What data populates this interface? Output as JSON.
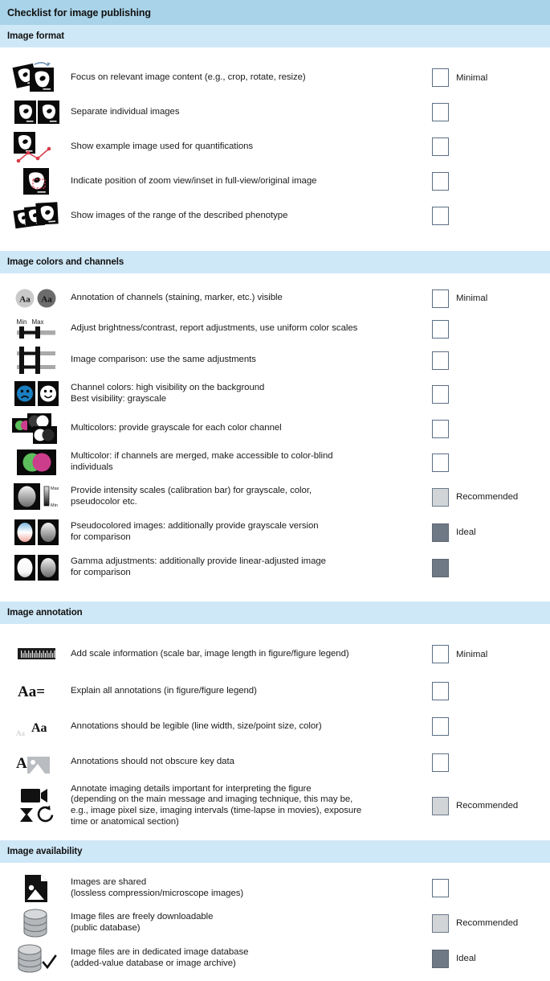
{
  "header": {
    "title": "Checklist for image publishing"
  },
  "levels": {
    "minimal": "Minimal",
    "recommended": "Recommended",
    "ideal": "Ideal"
  },
  "colors": {
    "title_bar": "#a9d3e9",
    "section_bar": "#cfe8f7",
    "checkbox_border": "#5b6f85",
    "recommended_fill": "#d2d5d8",
    "ideal_fill": "#6f7885",
    "text": "#1b1b1b",
    "accent_red": "#d93a4a",
    "accent_green": "#5cbf5c",
    "accent_magenta": "#cc3d8c",
    "accent_blue": "#1a7fc1"
  },
  "sections": [
    {
      "title": "Image format",
      "items": [
        {
          "icon": "crop-rotate-resize-icon",
          "lines": [
            "Focus on relevant image content (e.g., crop, rotate, resize)"
          ],
          "level": "minimal",
          "level_label": "Minimal"
        },
        {
          "icon": "separate-images-icon",
          "lines": [
            "Separate individual images"
          ],
          "level": "minimal",
          "level_label": ""
        },
        {
          "icon": "example-image-quantification-icon",
          "lines": [
            "Show example image used for quantifications"
          ],
          "level": "minimal",
          "level_label": ""
        },
        {
          "icon": "zoom-inset-position-icon",
          "lines": [
            "Indicate position of zoom view/inset in full-view/original image"
          ],
          "level": "minimal",
          "level_label": ""
        },
        {
          "icon": "phenotype-range-icon",
          "lines": [
            "Show images of the range of the described phenotype"
          ],
          "level": "minimal",
          "level_label": ""
        }
      ]
    },
    {
      "title": "Image colors and channels",
      "items": [
        {
          "icon": "channel-annotation-icon",
          "lines": [
            "Annotation of channels (staining, marker, etc.) visible"
          ],
          "level": "minimal",
          "level_label": "Minimal"
        },
        {
          "icon": "brightness-contrast-slider-icon",
          "icon_labels": [
            "Min",
            "Max"
          ],
          "lines": [
            "Adjust brightness/contrast, report adjustments, use uniform color scales"
          ],
          "level": "minimal",
          "level_label": ""
        },
        {
          "icon": "same-adjustments-sliders-icon",
          "lines": [
            "Image comparison: use the same adjustments"
          ],
          "level": "minimal",
          "level_label": ""
        },
        {
          "icon": "channel-visibility-faces-icon",
          "lines": [
            "Channel colors: high visibility on the background",
            "Best visibility: grayscale"
          ],
          "level": "minimal",
          "level_label": ""
        },
        {
          "icon": "multicolor-grayscale-split-icon",
          "lines": [
            "Multicolors: provide grayscale for each color channel"
          ],
          "level": "minimal",
          "level_label": ""
        },
        {
          "icon": "colorblind-merge-icon",
          "lines": [
            "Multicolor: if channels are merged, make accessible to color-blind",
            "individuals"
          ],
          "level": "minimal",
          "level_label": ""
        },
        {
          "icon": "calibration-bar-icon",
          "icon_labels": [
            "Max",
            "Min"
          ],
          "lines": [
            "Provide intensity scales (calibration bar) for grayscale, color,",
            "pseudocolor etc."
          ],
          "level": "recommended",
          "level_label": "Recommended"
        },
        {
          "icon": "pseudocolor-grayscale-pair-icon",
          "lines": [
            "Pseudocolored images: additionally provide grayscale version",
            "for comparison"
          ],
          "level": "ideal",
          "level_label": "Ideal"
        },
        {
          "icon": "gamma-linear-pair-icon",
          "lines": [
            "Gamma adjustments: additionally provide linear-adjusted image",
            "for comparison"
          ],
          "level": "ideal",
          "level_label": ""
        }
      ]
    },
    {
      "title": "Image annotation",
      "items": [
        {
          "icon": "scale-bar-icon",
          "lines": [
            "Add scale information (scale bar, image length in figure/figure legend)"
          ],
          "level": "minimal",
          "level_label": "Minimal"
        },
        {
          "icon": "explain-annotations-icon",
          "icon_text": "Aa=",
          "lines": [
            "Explain all annotations (in figure/figure legend)"
          ],
          "level": "minimal",
          "level_label": ""
        },
        {
          "icon": "legible-annotations-icon",
          "icon_text_small": "Aa",
          "icon_text_large": "Aa",
          "lines": [
            "Annotations should be legible (line width, size/point size, color)"
          ],
          "level": "minimal",
          "level_label": ""
        },
        {
          "icon": "obscure-key-data-icon",
          "icon_text": "A",
          "lines": [
            "Annotations should not obscure key data"
          ],
          "level": "minimal",
          "level_label": ""
        },
        {
          "icon": "imaging-details-icon",
          "lines": [
            "Annotate imaging details important for interpreting the figure",
            "(depending on the main message and imaging technique, this may be,",
            "e.g., image pixel size, imaging intervals (time-lapse in movies), exposure",
            "time or anatomical section)"
          ],
          "level": "recommended",
          "level_label": "Recommended"
        }
      ]
    },
    {
      "title": "Image availability",
      "items": [
        {
          "icon": "shared-image-icon",
          "lines": [
            "Images are shared",
            "(lossless compression/microscope images)"
          ],
          "level": "minimal",
          "level_label": ""
        },
        {
          "icon": "database-download-icon",
          "lines": [
            "Image files are freely downloadable",
            "(public database)"
          ],
          "level": "recommended",
          "level_label": "Recommended"
        },
        {
          "icon": "database-check-icon",
          "lines": [
            "Image files are in dedicated image database",
            "(added-value database or image archive)"
          ],
          "level": "ideal",
          "level_label": "Ideal"
        }
      ]
    }
  ]
}
